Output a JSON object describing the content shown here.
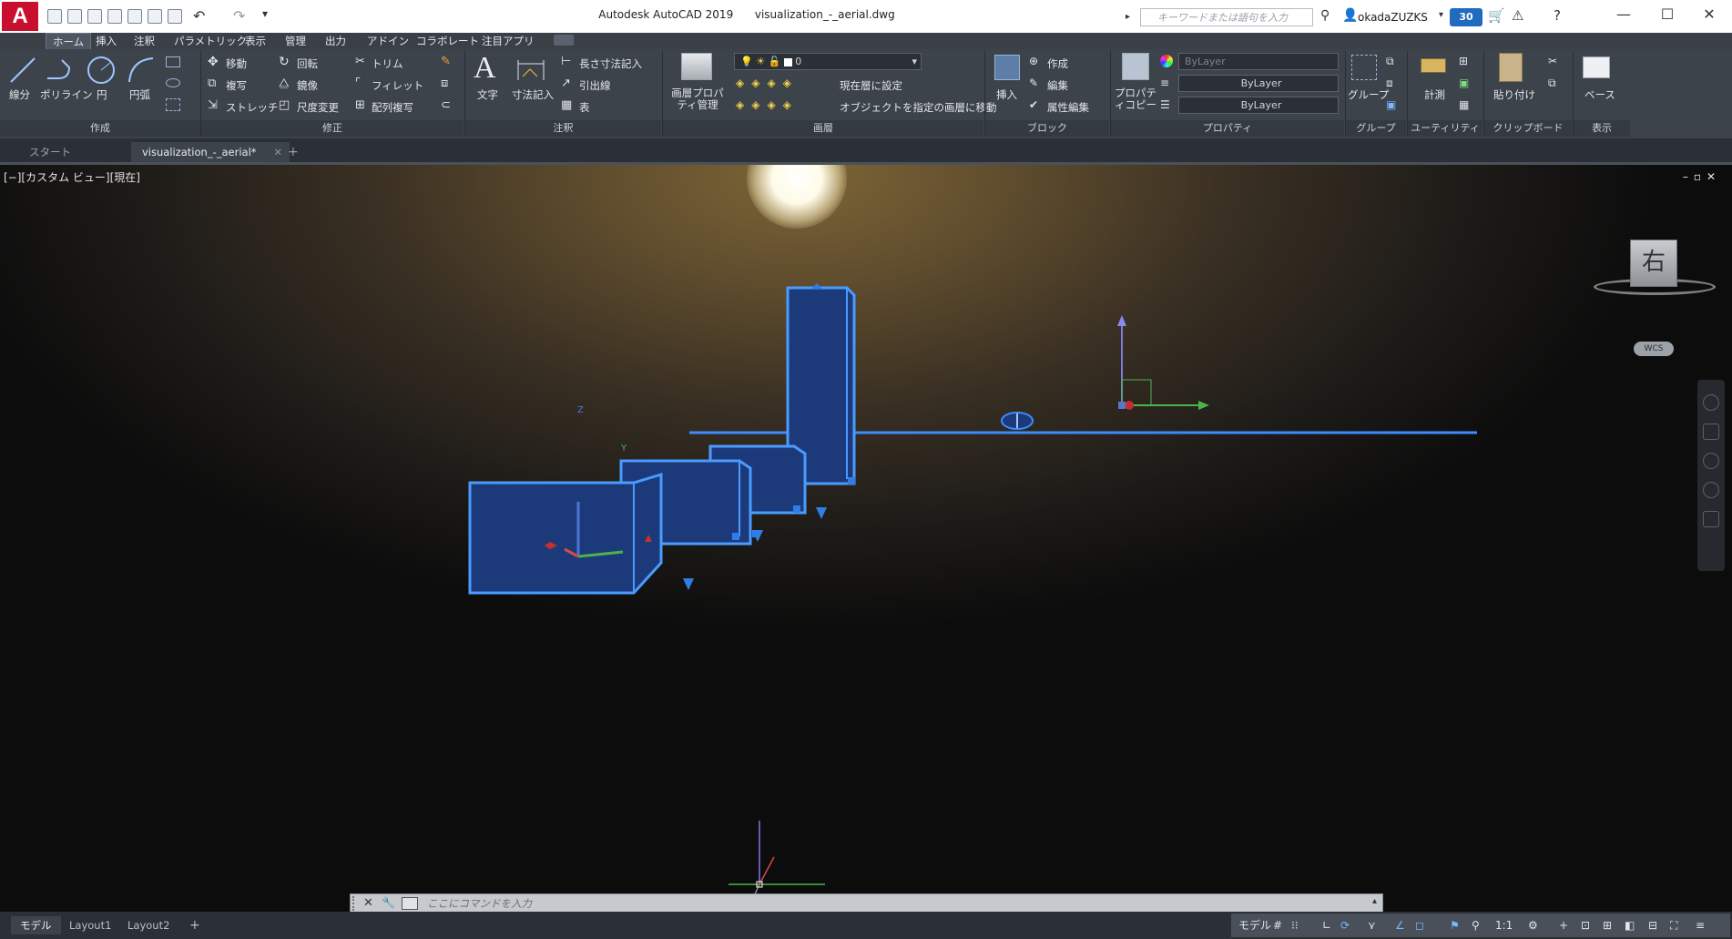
{
  "app": {
    "logo": "A",
    "title": "Autodesk AutoCAD 2019",
    "document": "visualization_-_aerial.dwg"
  },
  "search": {
    "placeholder": "キーワードまたは語句を入力"
  },
  "user": {
    "name": "okadaZUZKS",
    "timer": "30"
  },
  "menu_tabs": [
    "ホーム",
    "挿入",
    "注釈",
    "パラメトリック",
    "表示",
    "管理",
    "出力",
    "アドイン",
    "コラボレート",
    "注目アプリ"
  ],
  "ribbon": {
    "draw": {
      "line": "線分",
      "polyline": "ポリライン",
      "circle": "円",
      "arc": "円弧",
      "footer": "作成"
    },
    "modify": {
      "move": "移動",
      "rotate": "回転",
      "trim": "トリム",
      "copy": "複写",
      "mirror": "鏡像",
      "fillet": "フィレット",
      "stretch": "ストレッチ",
      "scale": "尺度変更",
      "array": "配列複写",
      "footer": "修正"
    },
    "annotation": {
      "text": "文字",
      "dimension": "寸法記入",
      "linear": "長さ寸法記入",
      "leader": "引出線",
      "table": "表",
      "footer": "注釈"
    },
    "layers": {
      "properties": "画層プロパティ管理",
      "current_layer": "0",
      "set_current": "現在層に設定",
      "match_layer": "オブジェクトを指定の画層に移動",
      "footer": "画層"
    },
    "block": {
      "insert": "挿入",
      "create": "作成",
      "edit": "編集",
      "attr_edit": "属性編集",
      "footer": "ブロック"
    },
    "properties": {
      "match": "プロパティコピー",
      "color": "ByLayer",
      "linetype": "ByLayer",
      "lineweight": "ByLayer",
      "footer": "プロパティ"
    },
    "groups": {
      "group": "グループ",
      "footer": "グループ"
    },
    "utilities": {
      "measure": "計測",
      "footer": "ユーティリティ"
    },
    "clipboard": {
      "paste": "貼り付け",
      "footer": "クリップボード"
    },
    "view": {
      "base": "ベース",
      "footer": "表示"
    }
  },
  "doc_tabs": [
    "スタート",
    "visualization_-_aerial*"
  ],
  "viewport": {
    "label": "[−][カスタム ビュー][現在]",
    "viewcube_face": "右",
    "wcs": "WCS",
    "axis_z": "Z",
    "axis_y": "Y"
  },
  "command": {
    "placeholder": "ここにコマンドを入力"
  },
  "layout_tabs": [
    "モデル",
    "Layout1",
    "Layout2"
  ],
  "status": {
    "model": "モデル",
    "scale": "1:1"
  },
  "colors": {
    "accent": "#1f6bbd",
    "selection": "#3d8bff",
    "box_fill": "#1c3a7a"
  }
}
